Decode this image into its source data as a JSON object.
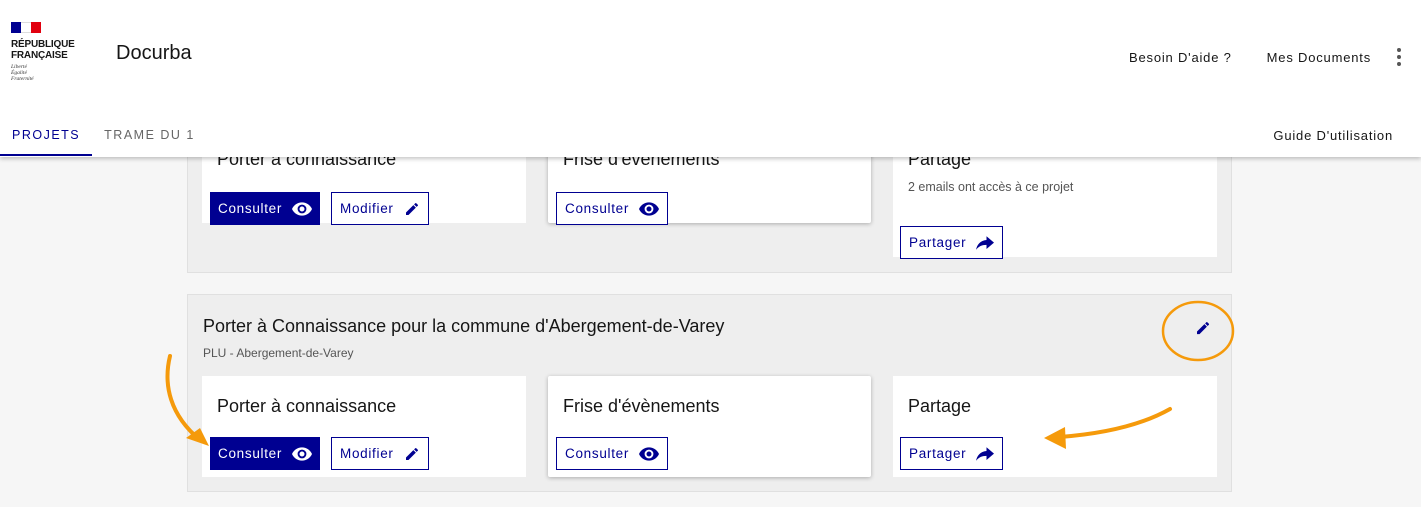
{
  "header": {
    "logo_lines": [
      "RÉPUBLIQUE",
      "FRANÇAISE"
    ],
    "motto_lines": [
      "Liberté",
      "Égalité",
      "Fraternité"
    ],
    "flag_colors": [
      "#000091",
      "#ffffff",
      "#e1000f"
    ],
    "app_name": "Docurba",
    "links": {
      "help": "Besoin D'aide ?",
      "documents": "Mes Documents"
    },
    "menu_icon": "kebab-menu-icon"
  },
  "tabs": [
    {
      "label": "PROJETS",
      "active": true
    },
    {
      "label": "TRAME DU 1",
      "active": false
    }
  ],
  "guide_link": "Guide D'utilisation",
  "project1": {
    "cards": {
      "porter": {
        "title": "Porter à connaissance",
        "consult": "Consulter",
        "modify": "Modifier"
      },
      "frise": {
        "title": "Frise d'évènements",
        "consult": "Consulter"
      },
      "partage": {
        "title": "Partage",
        "info": "2 emails ont accès à ce projet",
        "share": "Partager"
      }
    }
  },
  "project2": {
    "title": "Porter à Connaissance pour la commune d'Abergement-de-Varey",
    "subtitle": "PLU - Abergement-de-Varey",
    "cards": {
      "porter": {
        "title": "Porter à connaissance",
        "consult": "Consulter",
        "modify": "Modifier"
      },
      "frise": {
        "title": "Frise d'évènements",
        "consult": "Consulter"
      },
      "partage": {
        "title": "Partage",
        "share": "Partager"
      }
    }
  },
  "colors": {
    "primary": "#000091",
    "annotation": "#f59a0b",
    "background": "#f6f6f6"
  },
  "icons": [
    "eye-icon",
    "pencil-icon",
    "share-arrow-icon",
    "kebab-menu-icon"
  ]
}
